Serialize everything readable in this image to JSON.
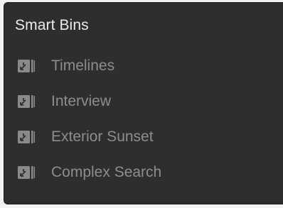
{
  "panel": {
    "title": "Smart Bins"
  },
  "bins": [
    {
      "label": "Timelines",
      "icon": "smart-bin-icon"
    },
    {
      "label": "Interview",
      "icon": "smart-bin-icon"
    },
    {
      "label": "Exterior Sunset",
      "icon": "smart-bin-icon"
    },
    {
      "label": "Complex Search",
      "icon": "smart-bin-icon"
    }
  ],
  "colors": {
    "panel_background": "#2e2e30",
    "title_text": "#ececec",
    "item_text": "#8d8d90",
    "icon": "#8a8a8c"
  }
}
